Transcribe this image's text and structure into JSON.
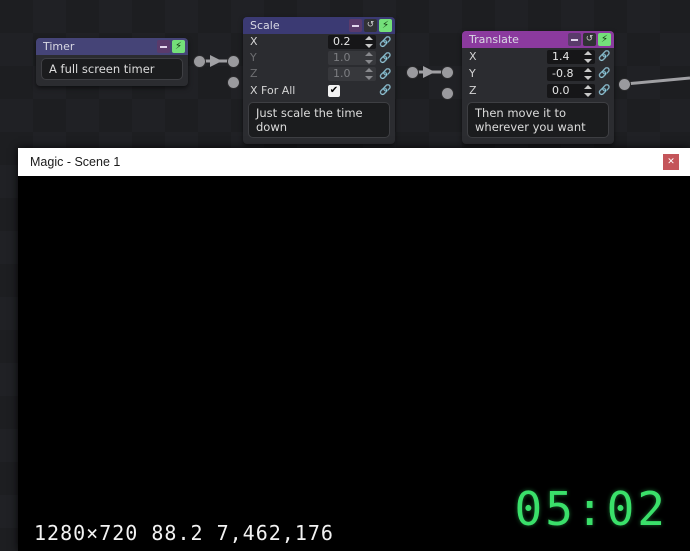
{
  "graph": {
    "nodes": [
      {
        "id": "timer",
        "title": "Timer",
        "header_color": "#454477",
        "buttons": [
          {
            "icon": "minus-icon",
            "label": "–"
          },
          {
            "icon": "lightning-bolt-icon",
            "label": "⚡"
          }
        ],
        "description": "A full screen timer"
      },
      {
        "id": "scale",
        "title": "Scale",
        "header_color": "#3b3a73",
        "buttons": [
          {
            "icon": "minus-icon",
            "label": "–"
          },
          {
            "icon": "refresh-circle-icon",
            "label": "↺"
          },
          {
            "icon": "lightning-bolt-icon",
            "label": "⚡"
          }
        ],
        "fields": [
          {
            "label": "X",
            "value": "0.2",
            "enabled": true,
            "link_icon": "link-icon"
          },
          {
            "label": "Y",
            "value": "1.0",
            "enabled": false,
            "link_icon": "link-icon"
          },
          {
            "label": "Z",
            "value": "1.0",
            "enabled": false,
            "link_icon": "link-icon"
          }
        ],
        "checkbox": {
          "label": "X For All",
          "checked": true,
          "mark": "✔",
          "link_icon": "link-icon"
        },
        "description": "Just scale the time down"
      },
      {
        "id": "translate",
        "title": "Translate",
        "header_color": "#8b3a9e",
        "buttons": [
          {
            "icon": "minus-icon",
            "label": "–"
          },
          {
            "icon": "refresh-circle-icon",
            "label": "↺"
          },
          {
            "icon": "lightning-bolt-icon",
            "label": "⚡"
          }
        ],
        "fields": [
          {
            "label": "X",
            "value": "1.4",
            "enabled": true,
            "link_icon": "link-icon"
          },
          {
            "label": "Y",
            "value": "-0.8",
            "enabled": true,
            "link_icon": "link-icon"
          },
          {
            "label": "Z",
            "value": "0.0",
            "enabled": true,
            "link_icon": "link-icon"
          }
        ],
        "description": "Then move it to\nwherever you want"
      }
    ]
  },
  "window": {
    "title": "Magic - Scene 1",
    "close_label": "✕",
    "clock": "05:02",
    "stats": "1280×720  88.2  7,462,176",
    "accent_green": "#3ae06a"
  }
}
